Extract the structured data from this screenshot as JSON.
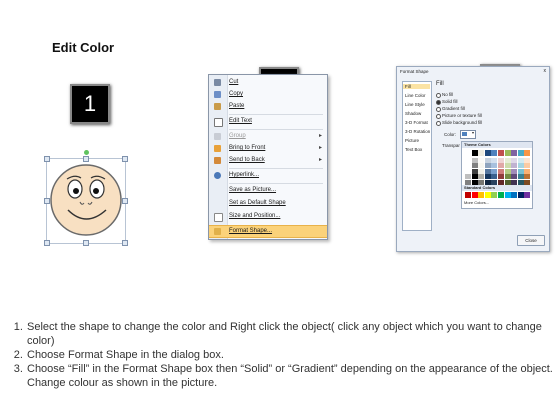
{
  "title": "Edit Color",
  "steps": [
    "1",
    "2",
    "3"
  ],
  "context_menu": {
    "items": [
      {
        "label": "Cut",
        "icon": "scissors-icon",
        "enabled": true,
        "submenu": false
      },
      {
        "label": "Copy",
        "icon": "copy-icon",
        "enabled": true,
        "submenu": false
      },
      {
        "label": "Paste",
        "icon": "paste-icon",
        "enabled": true,
        "submenu": false
      },
      {
        "label": "Edit Text",
        "icon": "edit-text-icon",
        "enabled": true,
        "submenu": false
      },
      {
        "label": "Group",
        "icon": "group-icon",
        "enabled": false,
        "submenu": true
      },
      {
        "label": "Bring to Front",
        "icon": "bring-front-icon",
        "enabled": true,
        "submenu": true
      },
      {
        "label": "Send to Back",
        "icon": "send-back-icon",
        "enabled": true,
        "submenu": true
      },
      {
        "label": "Hyperlink...",
        "icon": "hyperlink-icon",
        "enabled": true,
        "submenu": false
      },
      {
        "label": "Save as Picture...",
        "icon": "",
        "enabled": true,
        "submenu": false
      },
      {
        "label": "Set as Default Shape",
        "icon": "",
        "enabled": true,
        "submenu": false
      },
      {
        "label": "Size and Position...",
        "icon": "size-icon",
        "enabled": true,
        "submenu": false
      },
      {
        "label": "Format Shape...",
        "icon": "format-shape-icon",
        "enabled": true,
        "submenu": false,
        "highlighted": true
      }
    ]
  },
  "dialog": {
    "title": "Format Shape",
    "close_x": "x",
    "categories": [
      "Fill",
      "Line Color",
      "Line Style",
      "Shadow",
      "3-D Format",
      "3-D Rotation",
      "Picture",
      "Text Box"
    ],
    "fill_heading": "Fill",
    "fill_options": [
      "No fill",
      "Solid fill",
      "Gradient fill",
      "Picture or texture fill",
      "Slide background fill"
    ],
    "color_label": "Color:",
    "transparency_label": "Transpar",
    "close_button": "Close",
    "palette": {
      "theme_label": "Theme Colors",
      "standard_label": "Standard Colors",
      "more_label": "More Colors...",
      "theme_top": [
        "#ffffff",
        "#000000",
        "#eeece1",
        "#1f497d",
        "#4f81bd",
        "#c0504d",
        "#9bbb59",
        "#8064a2",
        "#4bacc6",
        "#f79646"
      ],
      "standard": [
        "#c00000",
        "#ff0000",
        "#ffc000",
        "#ffff00",
        "#92d050",
        "#00b050",
        "#00b0f0",
        "#0070c0",
        "#002060",
        "#7030a0"
      ]
    }
  },
  "instructions": [
    "Select the shape to change the color and Right click the object( click any object which you want to change color)",
    "Choose Format Shape in the dialog box.",
    "Choose “Fill” in the Format Shape box then “Solid” or “Gradient” depending on the appearance of the object. Change colour as shown in the picture."
  ]
}
